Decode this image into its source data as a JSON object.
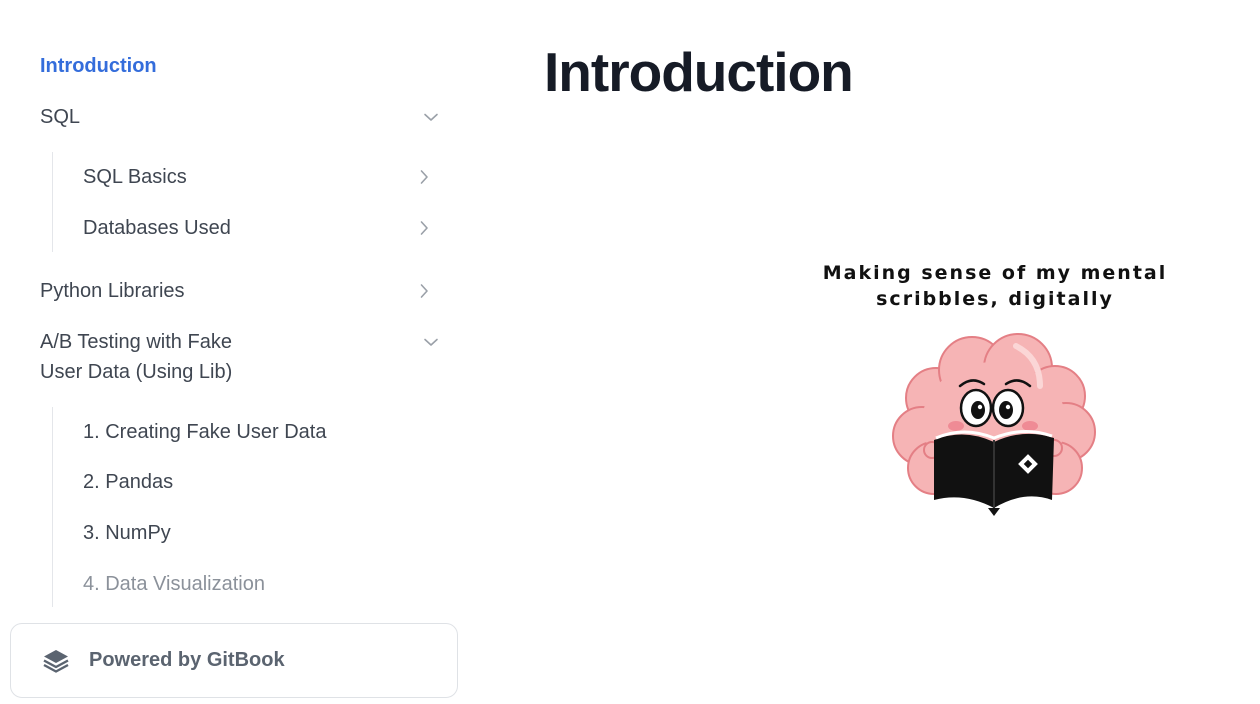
{
  "sidebar": {
    "items": [
      {
        "label": "Introduction"
      },
      {
        "label": "SQL"
      },
      {
        "label": "SQL Basics"
      },
      {
        "label": "Databases Used"
      },
      {
        "label": "Python Libraries"
      },
      {
        "label": "A/B Testing with Fake",
        "label_line2": "User Data (Using Lib)"
      },
      {
        "label": "1. Creating Fake User Data"
      },
      {
        "label": "2. Pandas"
      },
      {
        "label": "3. NumPy"
      },
      {
        "label": "4. Data Visualization"
      }
    ],
    "powered_by": "Powered by GitBook"
  },
  "main": {
    "title": "Introduction",
    "hero": {
      "tagline_line1": "Making sense of my mental",
      "tagline_line2": "scribbles, digitally"
    }
  },
  "colors": {
    "accent": "#346ddb",
    "title": "#161b26",
    "brain": "#f6b4b5",
    "book": "#000000"
  }
}
